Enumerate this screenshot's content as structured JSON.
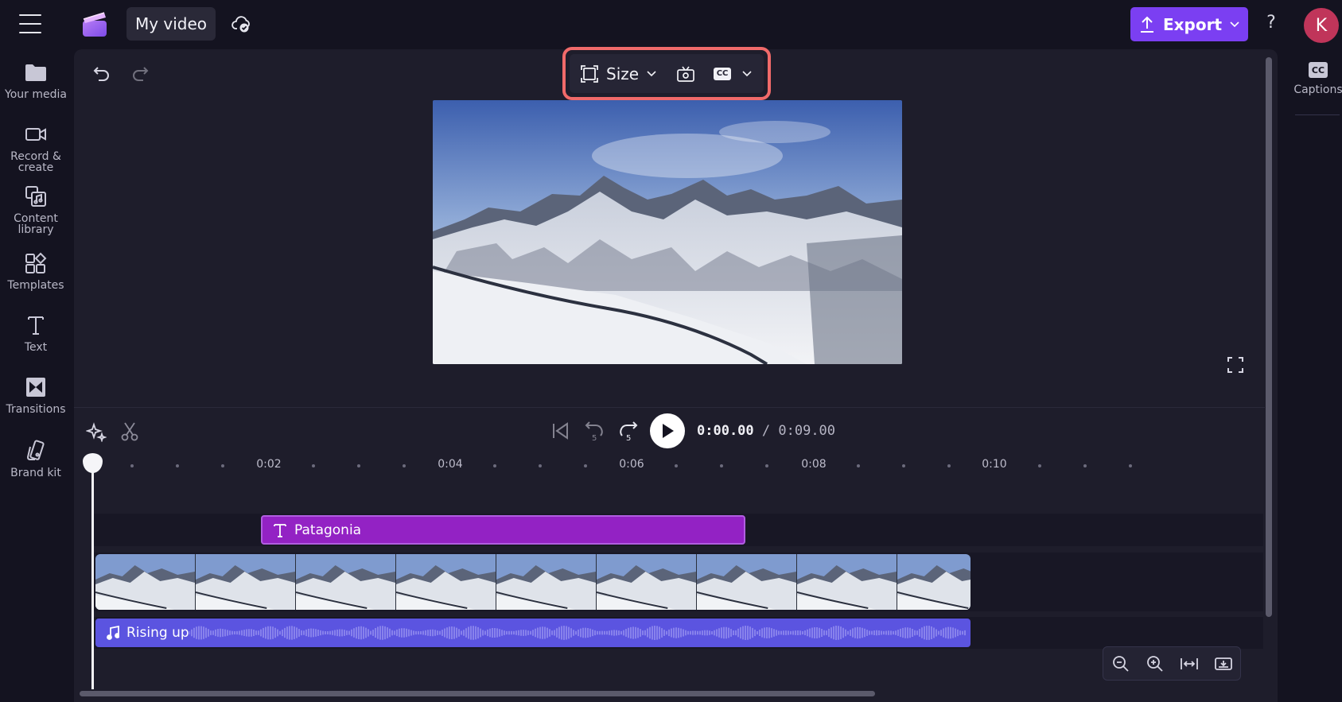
{
  "topbar": {
    "project_title": "My video",
    "export_label": "Export",
    "help_glyph": "?",
    "avatar_initial": "K"
  },
  "leftnav": {
    "items": [
      {
        "label": "Your media",
        "icon": "folder-icon"
      },
      {
        "label": "Record &\ncreate",
        "icon": "video-camera-icon"
      },
      {
        "label": "Content\nlibrary",
        "icon": "content-library-icon"
      },
      {
        "label": "Templates",
        "icon": "templates-icon"
      },
      {
        "label": "Text",
        "icon": "text-icon"
      },
      {
        "label": "Transitions",
        "icon": "transitions-icon"
      },
      {
        "label": "Brand kit",
        "icon": "brand-kit-icon"
      }
    ]
  },
  "rightnav": {
    "captions_label": "Captions",
    "captions_glyph": "CC"
  },
  "toolbar": {
    "size_label": "Size",
    "captions_glyph": "CC"
  },
  "playback": {
    "current_time": "0:00.00",
    "total_time": "/ 0:09.00",
    "skip_seconds": "5"
  },
  "timeline": {
    "ruler_labels": [
      "0:02",
      "0:04",
      "0:06",
      "0:08",
      "0:10"
    ],
    "text_clip_label": "Patagonia",
    "audio_clip_label": "Rising up",
    "video_thumbnail_count": 9
  },
  "colors": {
    "accent": "#7b3ff2",
    "text_clip": "#9322c4",
    "audio_clip": "#5b54e0",
    "highlight": "#f06a6a",
    "avatar": "#c0355a"
  }
}
